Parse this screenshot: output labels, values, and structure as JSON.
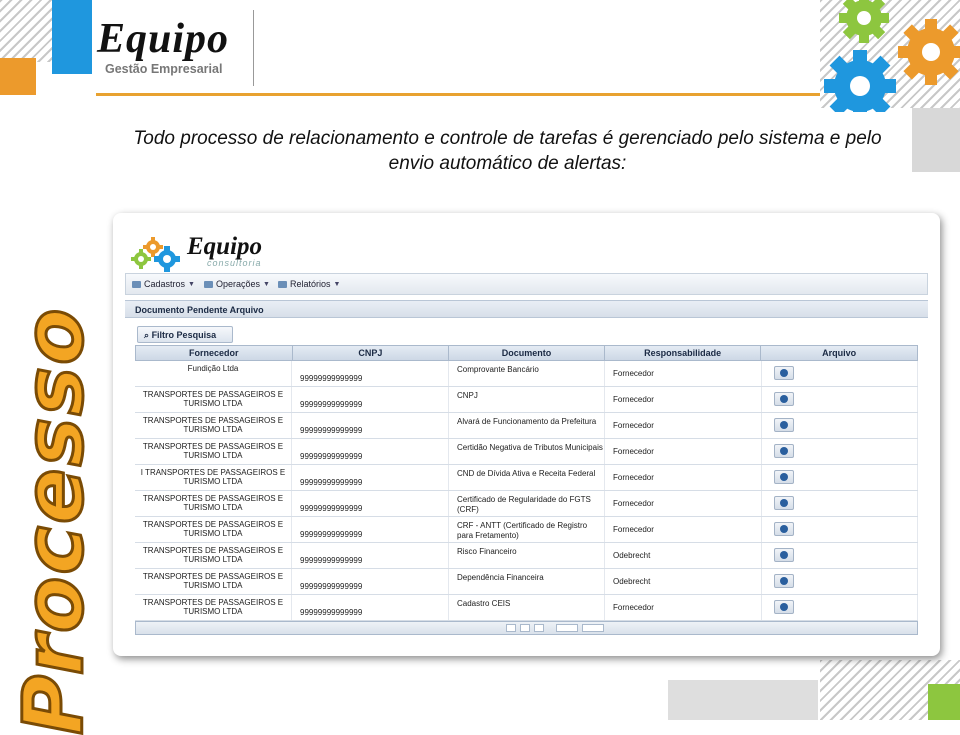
{
  "brand": {
    "logo_text": "Equipo",
    "logo_subtitle": "Gestão Empresarial",
    "accent_orange": "#e8a230",
    "accent_blue": "#1f97de",
    "accent_green": "#8dc63f"
  },
  "headline": {
    "line1": "Todo processo de relacionamento e controle de tarefas é gerenciado pelo sistema e pelo",
    "line2": "envio automático de alertas:"
  },
  "side_title": "Processo",
  "app": {
    "logo_text": "Equipo",
    "logo_subtitle": "consultoria",
    "menu": [
      {
        "label": "Cadastros",
        "icon": "folder-icon"
      },
      {
        "label": "Operações",
        "icon": "grid-icon"
      },
      {
        "label": "Relatórios",
        "icon": "report-icon"
      }
    ],
    "panel_title": "Documento Pendente Arquivo",
    "filter_button": "Filtro Pesquisa",
    "columns": [
      "Fornecedor",
      "CNPJ",
      "Documento",
      "Responsabilidade",
      "Arquivo"
    ],
    "rows": [
      {
        "fornecedor": "Fundição          Ltda",
        "cnpj": "99999999999999",
        "documento": "Comprovante Bancário",
        "responsabilidade": "Fornecedor"
      },
      {
        "fornecedor": "TRANSPORTES DE PASSAGEIROS E TURISMO LTDA",
        "cnpj": "99999999999999",
        "documento": "CNPJ",
        "responsabilidade": "Fornecedor"
      },
      {
        "fornecedor": "TRANSPORTES DE PASSAGEIROS E TURISMO LTDA",
        "cnpj": "99999999999999",
        "documento": "Alvará de Funcionamento da Prefeitura",
        "responsabilidade": "Fornecedor"
      },
      {
        "fornecedor": "TRANSPORTES DE PASSAGEIROS E TURISMO LTDA",
        "cnpj": "99999999999999",
        "documento": "Certidão Negativa de Tributos Municipais",
        "responsabilidade": "Fornecedor"
      },
      {
        "fornecedor": "I TRANSPORTES DE PASSAGEIROS E TURISMO LTDA",
        "cnpj": "99999999999999",
        "documento": "CND de Dívida Ativa e Receita Federal",
        "responsabilidade": "Fornecedor"
      },
      {
        "fornecedor": "TRANSPORTES DE PASSAGEIROS E TURISMO LTDA",
        "cnpj": "99999999999999",
        "documento": "Certificado de Regularidade do FGTS (CRF)",
        "responsabilidade": "Fornecedor"
      },
      {
        "fornecedor": "TRANSPORTES DE PASSAGEIROS E TURISMO LTDA",
        "cnpj": "99999999999999",
        "documento": "CRF - ANTT (Certificado de Registro para Fretamento)",
        "responsabilidade": "Fornecedor"
      },
      {
        "fornecedor": "TRANSPORTES DE PASSAGEIROS E TURISMO LTDA",
        "cnpj": "99999999999999",
        "documento": "Risco Financeiro",
        "responsabilidade": "Odebrecht"
      },
      {
        "fornecedor": "TRANSPORTES DE PASSAGEIROS E TURISMO LTDA",
        "cnpj": "99999999999999",
        "documento": "Dependência Financeira",
        "responsabilidade": "Odebrecht"
      },
      {
        "fornecedor": "TRANSPORTES DE PASSAGEIROS E TURISMO LTDA",
        "cnpj": "99999999999999",
        "documento": "Cadastro CEIS",
        "responsabilidade": "Fornecedor"
      }
    ]
  }
}
